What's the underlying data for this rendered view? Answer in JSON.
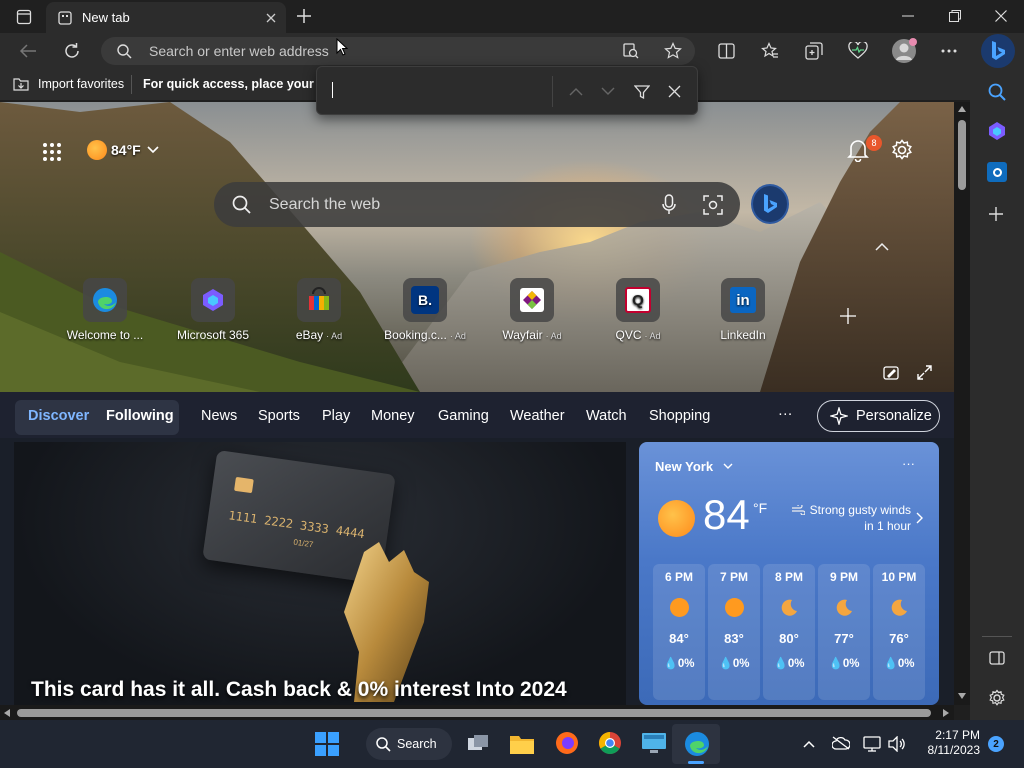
{
  "tab": {
    "title": "New tab"
  },
  "address_bar": {
    "placeholder": "Search or enter web address"
  },
  "favorites_bar": {
    "import_label": "Import favorites",
    "hint": "For quick access, place your favo"
  },
  "find_bar": {
    "value": ""
  },
  "header": {
    "temperature": "84°F",
    "notification_count": "8"
  },
  "search": {
    "placeholder": "Search the web"
  },
  "quick_links": [
    {
      "label": "Welcome to ...",
      "ad": ""
    },
    {
      "label": "Microsoft 365",
      "ad": ""
    },
    {
      "label": "eBay",
      "ad": "· Ad"
    },
    {
      "label": "Booking.c...",
      "ad": "· Ad",
      "glyph": "B."
    },
    {
      "label": "Wayfair",
      "ad": "· Ad"
    },
    {
      "label": "QVC",
      "ad": "· Ad",
      "glyph": "Q"
    },
    {
      "label": "LinkedIn",
      "ad": "",
      "glyph": "in"
    }
  ],
  "nav": {
    "discover": "Discover",
    "following": "Following",
    "items": [
      "News",
      "Sports",
      "Play",
      "Money",
      "Gaming",
      "Weather",
      "Watch",
      "Shopping"
    ],
    "more": "···",
    "personalize": "Personalize"
  },
  "feed": {
    "headline": "This card has it all. Cash back & 0% interest Into 2024",
    "card_number": "1111  2222  3333  4444",
    "card_expiry": "01/27"
  },
  "weather": {
    "location": "New York",
    "temp": "84",
    "unit": "°F",
    "alert_line1": "Strong gusty winds",
    "alert_line2": "in 1 hour",
    "more": "···",
    "hours": [
      {
        "time": "6 PM",
        "icon": "sun-icon",
        "temp": "84°",
        "precip": "0%"
      },
      {
        "time": "7 PM",
        "icon": "sun-icon",
        "temp": "83°",
        "precip": "0%"
      },
      {
        "time": "8 PM",
        "icon": "moon-icon",
        "temp": "80°",
        "precip": "0%"
      },
      {
        "time": "9 PM",
        "icon": "moon-icon",
        "temp": "77°",
        "precip": "0%"
      },
      {
        "time": "10 PM",
        "icon": "moon-icon",
        "temp": "76°",
        "precip": "0%"
      }
    ]
  },
  "taskbar": {
    "search_label": "Search",
    "time": "2:17 PM",
    "date": "8/11/2023",
    "notifications": "2"
  },
  "colors": {
    "accent": "#4aa3ff",
    "discover": "#7fb6ff",
    "badge": "#e8572c",
    "sun": "#ff9a1f",
    "weather_bg": "#4a78c8"
  }
}
